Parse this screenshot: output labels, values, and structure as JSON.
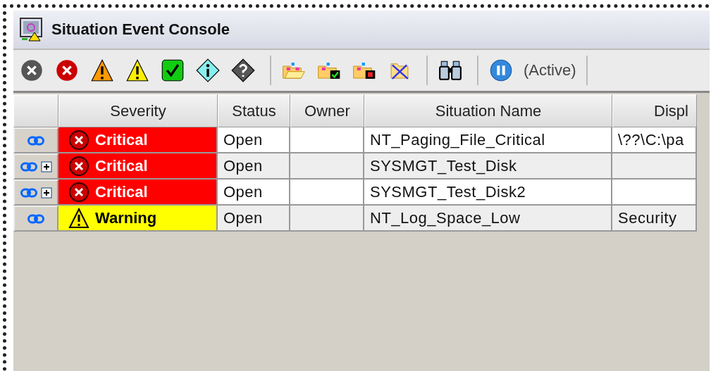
{
  "window": {
    "title": "Situation Event Console"
  },
  "toolbar": {
    "status": "(Active)"
  },
  "table": {
    "columns": [
      "Severity",
      "Status",
      "Owner",
      "Situation Name",
      "Displ"
    ],
    "rows": [
      {
        "expandable": false,
        "severity": {
          "kind": "critical",
          "label": "Critical"
        },
        "status": "Open",
        "situation_name": "NT_Paging_File_Critical",
        "column_5": "\\??\\C:\\pa"
      },
      {
        "expandable": true,
        "severity": {
          "kind": "critical",
          "label": "Critical"
        },
        "status": "Open",
        "situation_name": "SYSMGT_Test_Disk"
      },
      {
        "expandable": true,
        "severity": {
          "kind": "critical",
          "label": "Critical"
        },
        "status": "Open",
        "situation_name": "SYSMGT_Test_Disk2"
      },
      {
        "expandable": false,
        "severity": {
          "kind": "warning",
          "label": "Warning"
        },
        "status": "Open",
        "situation_name": "NT_Log_Space_Low",
        "column_5": "Security"
      }
    ]
  }
}
